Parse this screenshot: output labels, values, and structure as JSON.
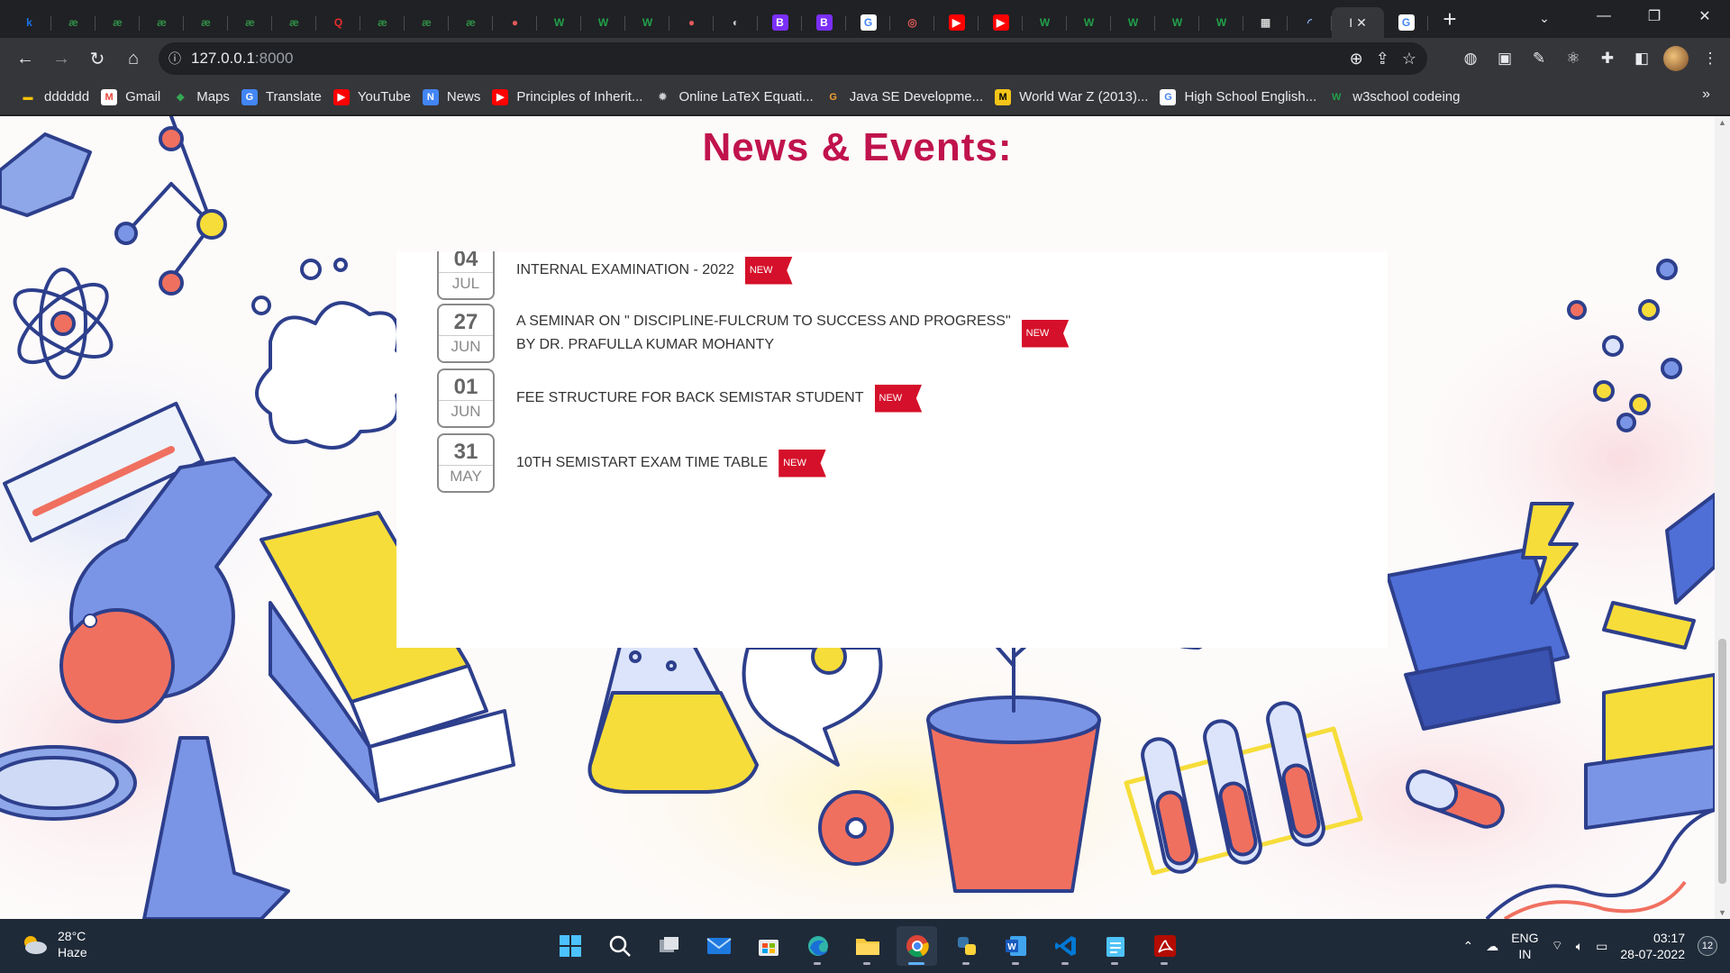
{
  "browser": {
    "tabs": [
      {
        "glyph": "k",
        "color": "#1a73e8",
        "bg": "transparent"
      },
      {
        "glyph": "æ",
        "color": "#2f8d46",
        "bg": "transparent"
      },
      {
        "glyph": "æ",
        "color": "#2f8d46",
        "bg": "transparent"
      },
      {
        "glyph": "æ",
        "color": "#2f8d46",
        "bg": "transparent"
      },
      {
        "glyph": "æ",
        "color": "#2f8d46",
        "bg": "transparent"
      },
      {
        "glyph": "æ",
        "color": "#2f8d46",
        "bg": "transparent"
      },
      {
        "glyph": "æ",
        "color": "#2f8d46",
        "bg": "transparent"
      },
      {
        "glyph": "Q",
        "color": "#e62e2e",
        "bg": "transparent"
      },
      {
        "glyph": "æ",
        "color": "#2f8d46",
        "bg": "transparent"
      },
      {
        "glyph": "æ",
        "color": "#2f8d46",
        "bg": "transparent"
      },
      {
        "glyph": "æ",
        "color": "#2f8d46",
        "bg": "transparent"
      },
      {
        "glyph": "●",
        "color": "#e05a5a",
        "bg": "transparent"
      },
      {
        "glyph": "W",
        "color": "#21a04a",
        "bg": "transparent"
      },
      {
        "glyph": "W",
        "color": "#21a04a",
        "bg": "transparent"
      },
      {
        "glyph": "W",
        "color": "#21a04a",
        "bg": "transparent"
      },
      {
        "glyph": "●",
        "color": "#e05a5a",
        "bg": "transparent"
      },
      {
        "glyph": "◐",
        "color": "#cfcfcf",
        "bg": "transparent"
      },
      {
        "glyph": "B",
        "color": "#ffffff",
        "bg": "#7b2ff7"
      },
      {
        "glyph": "B",
        "color": "#ffffff",
        "bg": "#7b2ff7"
      },
      {
        "glyph": "G",
        "color": "#4285f4",
        "bg": "#ffffff"
      },
      {
        "glyph": "◎",
        "color": "#e05a5a",
        "bg": "transparent"
      },
      {
        "glyph": "▶",
        "color": "#ffffff",
        "bg": "#ff0000"
      },
      {
        "glyph": "▶",
        "color": "#ffffff",
        "bg": "#ff0000"
      },
      {
        "glyph": "W",
        "color": "#21a04a",
        "bg": "transparent"
      },
      {
        "glyph": "W",
        "color": "#21a04a",
        "bg": "transparent"
      },
      {
        "glyph": "W",
        "color": "#21a04a",
        "bg": "transparent"
      },
      {
        "glyph": "W",
        "color": "#21a04a",
        "bg": "transparent"
      },
      {
        "glyph": "W",
        "color": "#21a04a",
        "bg": "transparent"
      },
      {
        "glyph": "▦",
        "color": "#cfcfcf",
        "bg": "transparent"
      },
      {
        "glyph": "◜",
        "color": "#8ab4f8",
        "bg": "transparent"
      }
    ],
    "active_tab": {
      "label": "I",
      "close": "✕"
    },
    "after_tab": {
      "glyph": "G",
      "color": "#4285f4",
      "bg": "#ffffff"
    },
    "new_tab": "+",
    "url_host": "127.0.0.1",
    "url_port": ":8000",
    "bookmarks": [
      {
        "label": "dddddd",
        "icon": "folder-icon",
        "glyph": "▬",
        "color": "#f4c20d",
        "bg": "transparent"
      },
      {
        "label": "Gmail",
        "icon": "gmail-icon",
        "glyph": "M",
        "color": "#ea4335",
        "bg": "#ffffff"
      },
      {
        "label": "Maps",
        "icon": "maps-icon",
        "glyph": "◆",
        "color": "#34a853",
        "bg": "transparent"
      },
      {
        "label": "Translate",
        "icon": "translate-icon",
        "glyph": "G",
        "color": "#ffffff",
        "bg": "#4285f4"
      },
      {
        "label": "YouTube",
        "icon": "youtube-icon",
        "glyph": "▶",
        "color": "#ffffff",
        "bg": "#ff0000"
      },
      {
        "label": "News",
        "icon": "news-icon",
        "glyph": "N",
        "color": "#ffffff",
        "bg": "#4285f4"
      },
      {
        "label": "Principles of Inherit...",
        "icon": "youtube-icon",
        "glyph": "▶",
        "color": "#ffffff",
        "bg": "#ff0000"
      },
      {
        "label": "Online LaTeX Equati...",
        "icon": "gear-icon",
        "glyph": "✹",
        "color": "#cfcfcf",
        "bg": "transparent"
      },
      {
        "label": "Java SE Developme...",
        "icon": "java-icon",
        "glyph": "G",
        "color": "#f0a030",
        "bg": "transparent"
      },
      {
        "label": "World War Z (2013)...",
        "icon": "imdb-icon",
        "glyph": "M",
        "color": "#000000",
        "bg": "#f5c518"
      },
      {
        "label": "High School English...",
        "icon": "google-icon",
        "glyph": "G",
        "color": "#4285f4",
        "bg": "#ffffff"
      },
      {
        "label": "w3school codeing",
        "icon": "w3-icon",
        "glyph": "W",
        "color": "#21a04a",
        "bg": "transparent"
      }
    ],
    "bookmarks_more": "»"
  },
  "page": {
    "title": "News & Events:",
    "accent_color": "#c0134d",
    "new_label": "New",
    "items": [
      {
        "day": "04",
        "month": "JUL",
        "lines": [
          "INTERNAL EXAMINATION - 2022"
        ]
      },
      {
        "day": "27",
        "month": "JUN",
        "lines": [
          "A SEMINAR ON \" DISCIPLINE-FULCRUM TO SUCCESS AND PROGRESS\"",
          "BY DR. PRAFULLA KUMAR MOHANTY"
        ]
      },
      {
        "day": "01",
        "month": "JUN",
        "lines": [
          "FEE STRUCTURE FOR BACK SEMISTAR STUDENT"
        ]
      },
      {
        "day": "31",
        "month": "MAY",
        "lines": [
          "10TH SEMISTART EXAM TIME TABLE"
        ]
      }
    ]
  },
  "taskbar": {
    "temperature": "28°C",
    "condition": "Haze",
    "language": "ENG",
    "region": "IN",
    "time": "03:17",
    "date": "28-07-2022",
    "notifications": "12",
    "apps": [
      {
        "name": "start-button",
        "icon": "windows-icon",
        "active": false
      },
      {
        "name": "search-button",
        "icon": "search-icon",
        "active": false
      },
      {
        "name": "task-view-button",
        "icon": "task-view-icon",
        "active": false
      },
      {
        "name": "mail-app",
        "icon": "mail-icon",
        "active": false
      },
      {
        "name": "store-app",
        "icon": "store-icon",
        "active": false
      },
      {
        "name": "edge-app",
        "icon": "edge-icon",
        "active": false
      },
      {
        "name": "file-explorer-app",
        "icon": "folder-icon",
        "active": false
      },
      {
        "name": "chrome-app",
        "icon": "chrome-icon",
        "active": true
      },
      {
        "name": "python-app",
        "icon": "python-icon",
        "active": false
      },
      {
        "name": "word-app",
        "icon": "word-icon",
        "active": false
      },
      {
        "name": "vscode-app",
        "icon": "vscode-icon",
        "active": false
      },
      {
        "name": "notepad-app",
        "icon": "notepad-icon",
        "active": false
      },
      {
        "name": "acrobat-app",
        "icon": "acrobat-icon",
        "active": false
      }
    ]
  }
}
